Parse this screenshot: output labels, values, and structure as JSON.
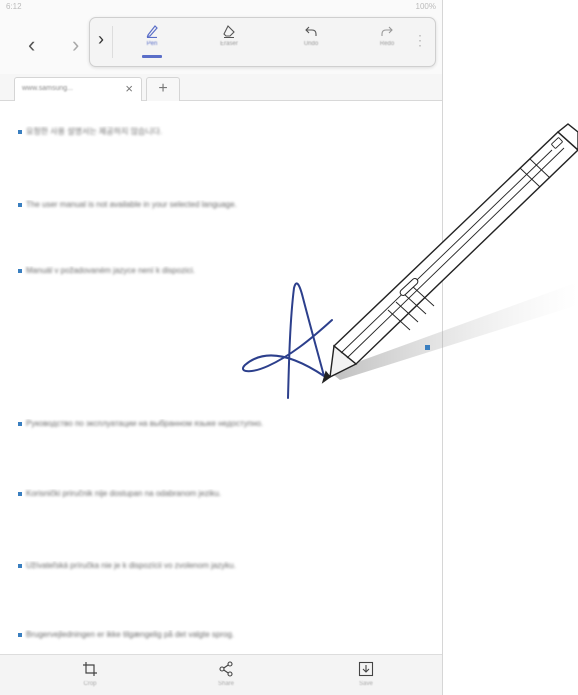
{
  "status_bar": {
    "left": "6:12",
    "right": "100%"
  },
  "toolbar": {
    "collapse_icon": "chevron-right-icon",
    "tools": [
      {
        "name": "pen",
        "label": "Pen",
        "icon": "pen-icon",
        "active": true
      },
      {
        "name": "eraser",
        "label": "Eraser",
        "icon": "eraser-icon",
        "active": false
      },
      {
        "name": "undo",
        "label": "Undo",
        "icon": "undo-icon",
        "active": false
      },
      {
        "name": "redo",
        "label": "Redo",
        "icon": "redo-icon",
        "active": false
      }
    ]
  },
  "tabs": {
    "active_title": "www.samsung...",
    "close_glyph": "×",
    "new_glyph": "+"
  },
  "content": {
    "lines": [
      "요청한 사용 설명서는 제공하지 않습니다.",
      "The user manual is not available in your selected language.",
      "Manuál v požadovaném jazyce není k dispozici.",
      "Руководство по эксплуатации на выбранном языке недоступно.",
      "Korisnički priručnik nije dostupan na odabranom jeziku.",
      "Užívateľská príručka nie je k dispozícii vo zvolenom jazyku.",
      "Brugervejledningen er ikke tilgængelig på det valgte sprog."
    ]
  },
  "bottom_bar": {
    "buttons": [
      {
        "label": "Crop",
        "icon": "crop-icon"
      },
      {
        "label": "Share",
        "icon": "share-icon"
      },
      {
        "label": "Save",
        "icon": "save-icon"
      }
    ]
  },
  "colors": {
    "accent": "#5a6ec8",
    "ink": "#2c3f8c",
    "bullet": "#3a7fc0"
  }
}
